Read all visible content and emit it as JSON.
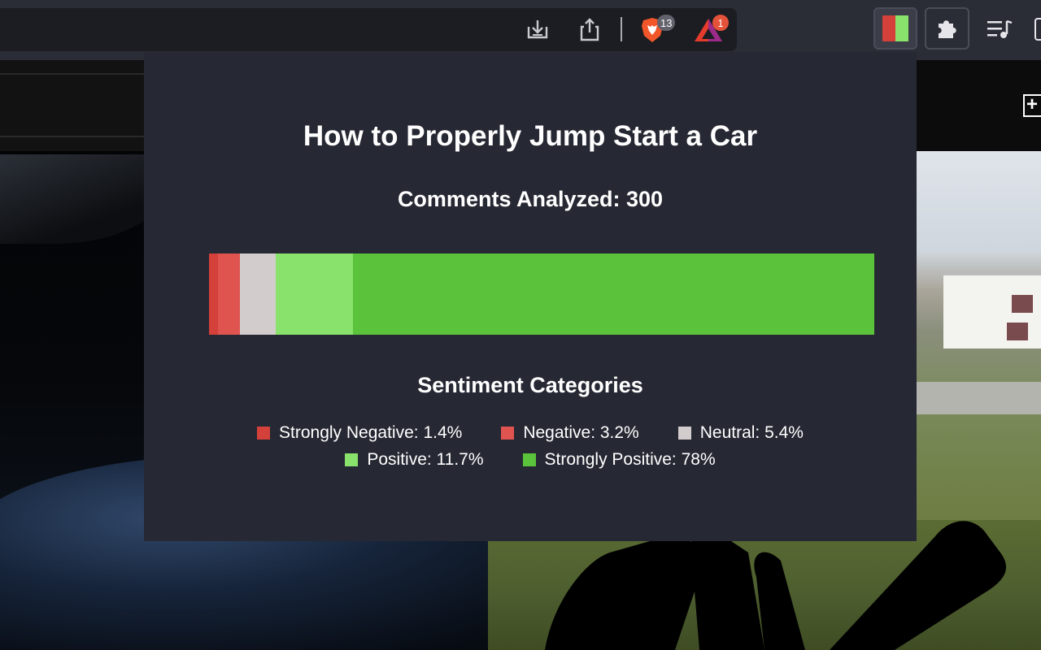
{
  "browser": {
    "brave_shields_count": "13",
    "rewards_count": "1"
  },
  "popup": {
    "title": "How to Properly Jump Start a Car",
    "comments_label": "Comments Analyzed: 300",
    "legend_heading": "Sentiment Categories",
    "categories": [
      {
        "label": "Strongly Negative: 1.4%",
        "percent": 1.4,
        "color": "#d4403a"
      },
      {
        "label": "Negative: 3.2%",
        "percent": 3.2,
        "color": "#e0544f"
      },
      {
        "label": "Neutral: 5.4%",
        "percent": 5.4,
        "color": "#d2cccd"
      },
      {
        "label": "Positive: 11.7%",
        "percent": 11.7,
        "color": "#89e26c"
      },
      {
        "label": "Strongly Positive: 78%",
        "percent": 78.3,
        "color": "#5bc23b"
      }
    ]
  },
  "colors": {
    "chrome_bg": "#2b2d36",
    "url_bar_bg": "#1c1d22",
    "popup_bg": "#262833",
    "brave_orange": "#f1562b",
    "badge_gray": "#60626c"
  },
  "icons": {
    "download": "download-icon",
    "share": "share-icon",
    "brave_shields": "brave-shields-icon",
    "brave_rewards": "brave-rewards-icon",
    "extension_sentiment": "sentiment-extension-icon",
    "extensions": "puzzle-icon",
    "media": "playlist-icon",
    "add": "add-icon"
  }
}
